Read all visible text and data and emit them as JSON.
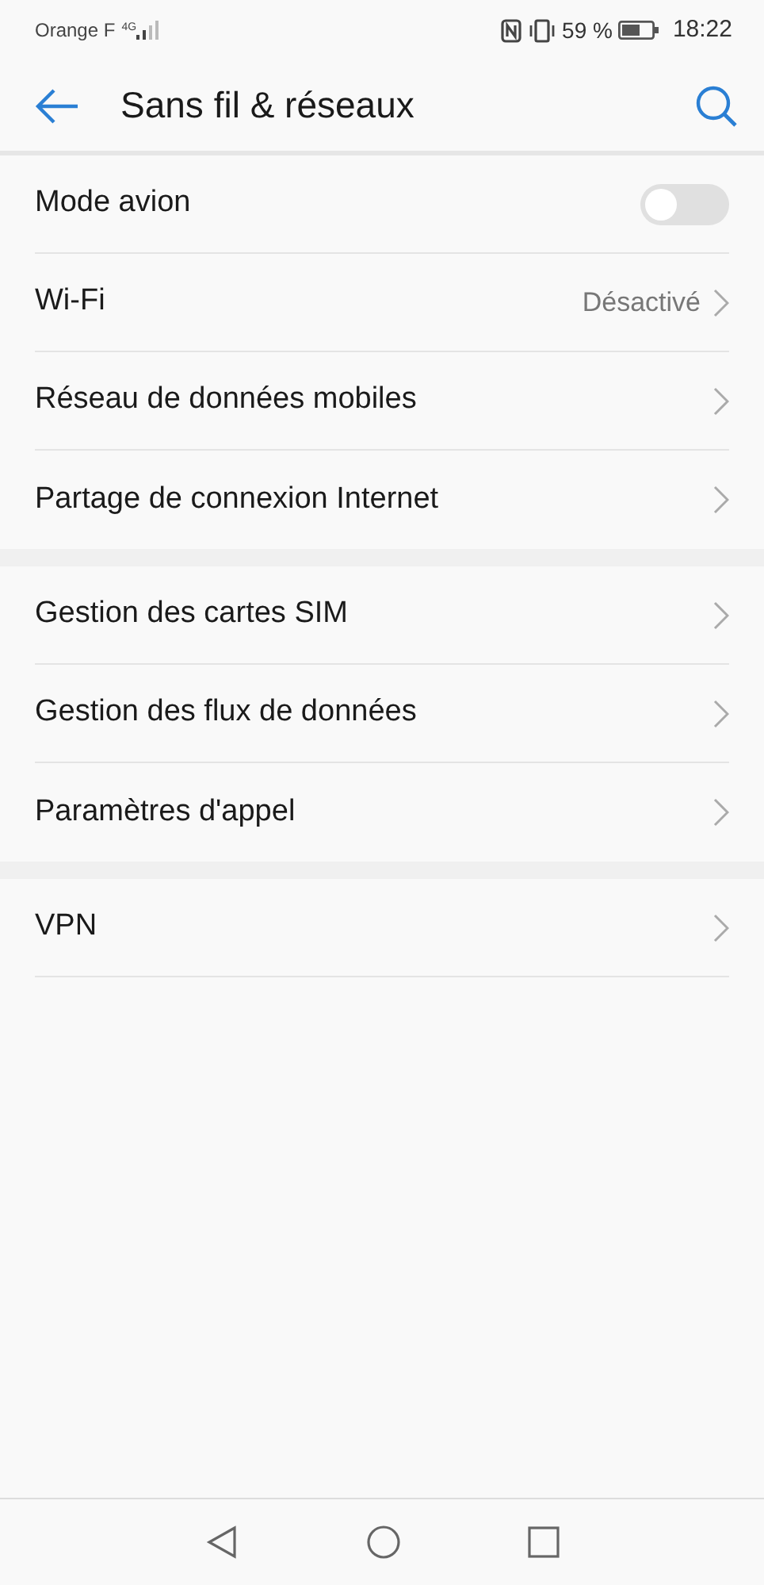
{
  "status_bar": {
    "carrier": "Orange F",
    "network": "4G",
    "battery": "59 %",
    "time": "18:22"
  },
  "header": {
    "title": "Sans fil & réseaux"
  },
  "groups": [
    {
      "items": [
        {
          "kind": "switch",
          "label": "Mode avion",
          "on": false
        },
        {
          "kind": "link",
          "label": "Wi-Fi",
          "value": "Désactivé"
        },
        {
          "kind": "link",
          "label": "Réseau de données mobiles"
        },
        {
          "kind": "link",
          "label": "Partage de connexion Internet"
        }
      ]
    },
    {
      "items": [
        {
          "kind": "link",
          "label": "Gestion des cartes SIM"
        },
        {
          "kind": "link",
          "label": "Gestion des flux de données"
        },
        {
          "kind": "link",
          "label": "Paramètres d'appel"
        }
      ]
    },
    {
      "items": [
        {
          "kind": "link",
          "label": "VPN"
        }
      ]
    }
  ]
}
